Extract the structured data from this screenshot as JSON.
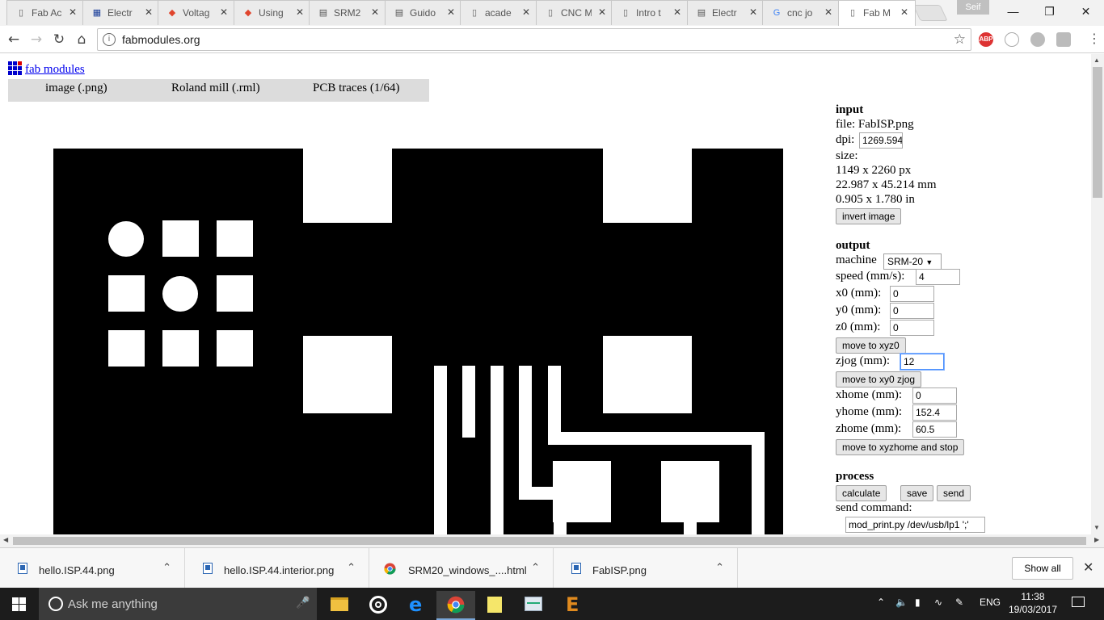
{
  "tabs": [
    {
      "label": "Fab Ac",
      "icon": "page-icon"
    },
    {
      "label": "Electr",
      "icon": "grid-icon"
    },
    {
      "label": "Voltag",
      "icon": "pdf-icon"
    },
    {
      "label": "Using",
      "icon": "pdf-icon"
    },
    {
      "label": "SRM2",
      "icon": "book-icon"
    },
    {
      "label": "Guido",
      "icon": "book-icon"
    },
    {
      "label": "acade",
      "icon": "page-icon"
    },
    {
      "label": "CNC M",
      "icon": "page-icon"
    },
    {
      "label": "Intro t",
      "icon": "page-icon"
    },
    {
      "label": "Electr",
      "icon": "book-icon"
    },
    {
      "label": "cnc jo",
      "icon": "google-icon"
    },
    {
      "label": "Fab M",
      "icon": "page-icon",
      "active": true
    }
  ],
  "profile_name": "Seif",
  "address": {
    "url": "fabmodules.org"
  },
  "extensions": {
    "abp": "ABP"
  },
  "page": {
    "title_link": "fab modules",
    "modules": [
      "image (.png)",
      "Roland mill (.rml)",
      "PCB traces (1/64)"
    ],
    "input": {
      "heading": "input",
      "file_label": "file:",
      "file_name": "FabISP.png",
      "dpi_label": "dpi:",
      "dpi_value": "1269.594",
      "size_label": "size:",
      "size_px": "1149 x 2260 px",
      "size_mm": "22.987 x 45.214 mm",
      "size_in": "0.905 x 1.780 in",
      "invert_button": "invert image"
    },
    "output": {
      "heading": "output",
      "machine_label": "machine",
      "machine_value": "SRM-20",
      "speed_label": "speed (mm/s):",
      "speed_value": "4",
      "x0_label": "x0 (mm):",
      "x0_value": "0",
      "y0_label": "y0 (mm):",
      "y0_value": "0",
      "z0_label": "z0 (mm):",
      "z0_value": "0",
      "move_xyz0_button": "move to xyz0",
      "zjog_label": "zjog (mm):",
      "zjog_value": "12",
      "move_xy0_button": "move to xy0 zjog",
      "xhome_label": "xhome (mm):",
      "xhome_value": "0",
      "yhome_label": "yhome (mm):",
      "yhome_value": "152.4",
      "zhome_label": "zhome (mm):",
      "zhome_value": "60.5",
      "move_home_button": "move to xyzhome and stop"
    },
    "process": {
      "heading": "process",
      "calculate_button": "calculate",
      "save_button": "save",
      "send_button": "send",
      "send_command_label": "send command:",
      "send_command_value": "mod_print.py /dev/usb/lp1 ';'"
    }
  },
  "downloads": [
    {
      "name": "hello.ISP.44.png"
    },
    {
      "name": "hello.ISP.44.interior.png"
    },
    {
      "name": "SRM20_windows_....html"
    },
    {
      "name": "FabISP.png"
    }
  ],
  "downloads_show_all": "Show all",
  "taskbar": {
    "search_placeholder": "Ask me anything",
    "language": "ENG",
    "time": "11:38",
    "date": "19/03/2017"
  },
  "colors": {
    "link": "#0000ee",
    "taskbar": "#1c1c1c",
    "modbar": "#dcdcdc"
  }
}
